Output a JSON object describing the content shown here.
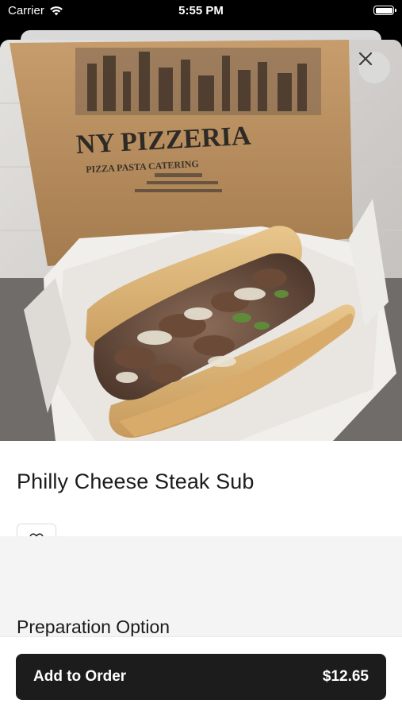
{
  "status_bar": {
    "carrier": "Carrier",
    "time": "5:55 PM",
    "wifi_icon": "wifi-icon",
    "battery_icon": "battery-icon"
  },
  "hero": {
    "box_text_line1": "NY PIZZERIA",
    "box_text_line2": "PIZZA  PASTA  CATERING",
    "close_icon": "close-icon"
  },
  "item": {
    "title": "Philly Cheese Steak Sub",
    "favorite_icon": "heart-icon"
  },
  "sections": {
    "preparation_title": "Preparation Option"
  },
  "footer": {
    "add_label": "Add to Order",
    "price": "$12.65"
  },
  "colors": {
    "button_bg": "#1c1c1c",
    "section_bg": "#f4f4f4"
  }
}
